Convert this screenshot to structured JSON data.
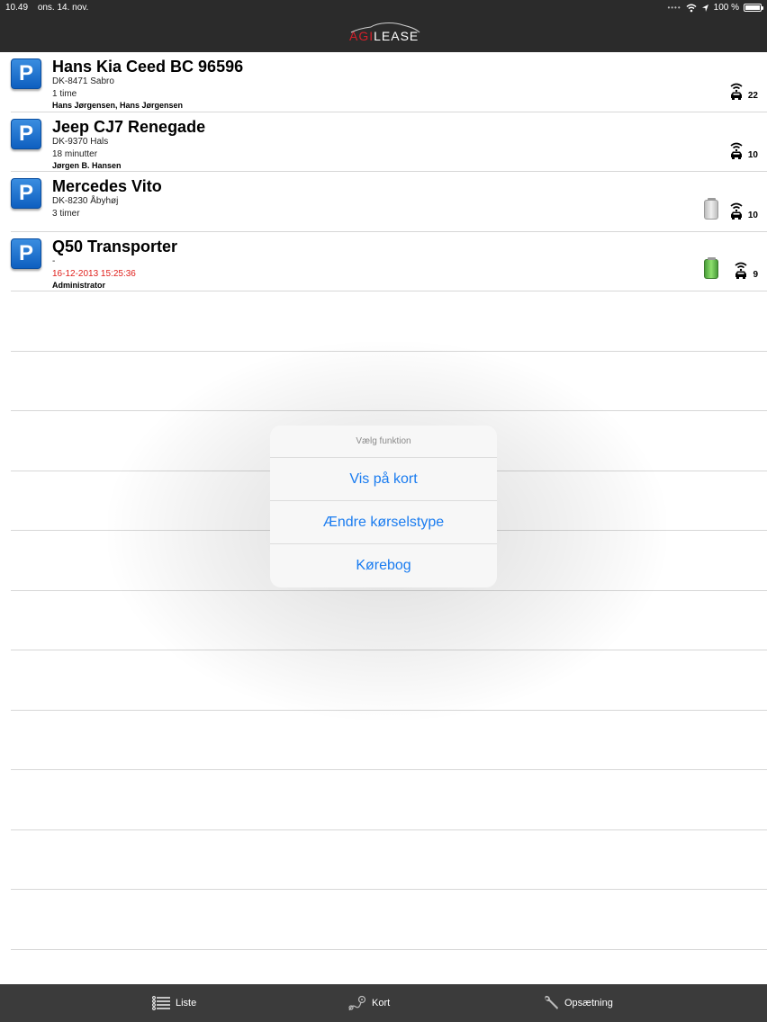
{
  "status_bar": {
    "time": "10.49",
    "date": "ons. 14. nov.",
    "battery": "100 %"
  },
  "header": {
    "logo_part1": "AGI",
    "logo_part2": "LEASE"
  },
  "vehicles": [
    {
      "title": "Hans Kia Ceed BC 96596",
      "location": "DK-8471 Sabro",
      "time": "1 time",
      "drivers": "Hans Jørgensen, Hans Jørgensen",
      "signal_count": "22",
      "canister": "none",
      "time_color": "normal"
    },
    {
      "title": "Jeep CJ7 Renegade",
      "location": "DK-9370 Hals",
      "time": "18 minutter",
      "drivers": "Jørgen B. Hansen",
      "signal_count": "10",
      "canister": "none",
      "time_color": "normal"
    },
    {
      "title": "Mercedes Vito",
      "location": "DK-8230 Åbyhøj",
      "time": "3 timer",
      "drivers": "",
      "signal_count": "10",
      "canister": "grey",
      "time_color": "normal"
    },
    {
      "title": "Q50 Transporter",
      "location": "-",
      "time": "16-12-2013 15:25:36",
      "drivers": "Administrator",
      "signal_count": "9",
      "canister": "green",
      "time_color": "red"
    }
  ],
  "popup": {
    "header": "Vælg funktion",
    "items": [
      "Vis på kort",
      "Ændre kørselstype",
      "Kørebog"
    ]
  },
  "tabbar": {
    "tabs": [
      "Liste",
      "Kort",
      "Opsætning"
    ]
  },
  "colors": {
    "accent_blue": "#1a7cf0",
    "logo_red": "#d2202a",
    "alert_red": "#e0201c"
  }
}
